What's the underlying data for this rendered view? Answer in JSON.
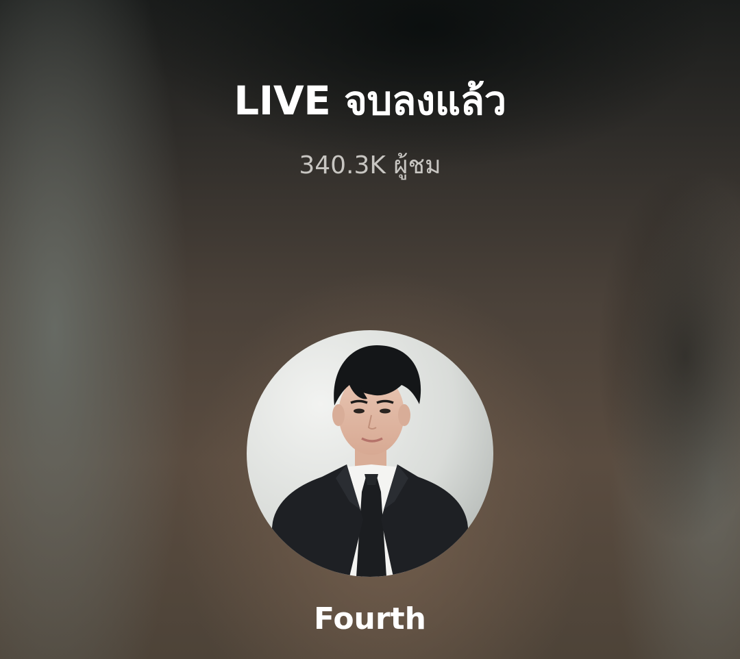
{
  "live_end": {
    "title": "LIVE จบลงแล้ว",
    "viewer_count": "340.3K ผู้ชม"
  },
  "host": {
    "username": "Fourth",
    "avatar": "profile-photo-man-in-black-suit"
  },
  "colors": {
    "title_text": "#ffffff",
    "viewer_text": "#c8c6c2",
    "background_warm": "#5a4c40",
    "background_dark": "#1a1c1b"
  }
}
